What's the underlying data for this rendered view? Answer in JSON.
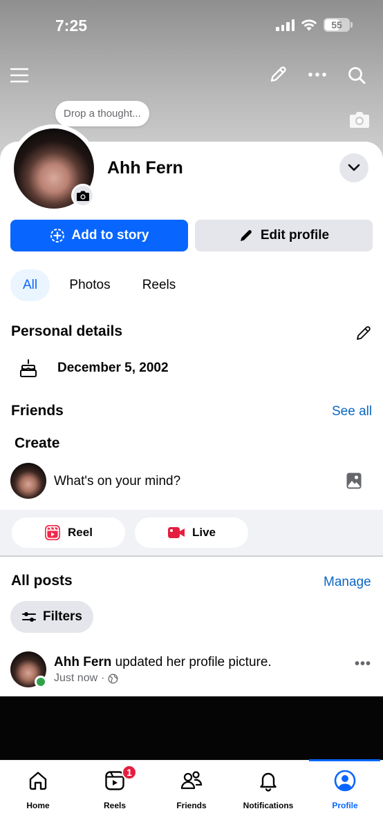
{
  "status_bar": {
    "time": "7:25",
    "battery": "55",
    "battery_level": 0.55
  },
  "header": {
    "menu_icon": "hamburger-menu-icon",
    "edit_icon": "pencil-icon",
    "more_icon": "more-horizontal-icon",
    "search_icon": "search-icon",
    "cover_camera_icon": "camera-icon"
  },
  "thought_bubble": {
    "placeholder": "Drop a thought..."
  },
  "profile": {
    "name": "Ahh Fern"
  },
  "actions": {
    "add_story_label": "Add to story",
    "edit_profile_label": "Edit profile"
  },
  "tabs": [
    {
      "label": "All",
      "active": true
    },
    {
      "label": "Photos",
      "active": false
    },
    {
      "label": "Reels",
      "active": false
    }
  ],
  "personal_details": {
    "title": "Personal details",
    "birthday": "December 5, 2002"
  },
  "friends": {
    "title": "Friends",
    "see_all_label": "See all"
  },
  "create": {
    "title": "Create",
    "prompt": "What's on your mind?",
    "reel_label": "Reel",
    "live_label": "Live"
  },
  "posts": {
    "title": "All posts",
    "manage_label": "Manage",
    "filters_label": "Filters",
    "items": [
      {
        "author": "Ahh Fern",
        "action": " updated her profile picture.",
        "time": "Just now",
        "separator": "·"
      }
    ]
  },
  "bottom_nav": [
    {
      "label": "Home",
      "icon": "home-icon",
      "active": false
    },
    {
      "label": "Reels",
      "icon": "reels-icon",
      "active": false,
      "badge": "1"
    },
    {
      "label": "Friends",
      "icon": "friends-icon",
      "active": false
    },
    {
      "label": "Notifications",
      "icon": "bell-icon",
      "active": false
    },
    {
      "label": "Profile",
      "icon": "profile-icon",
      "active": true
    }
  ],
  "colors": {
    "accent": "#0866ff",
    "link": "#0a66c2",
    "online": "#31a24c",
    "badge": "#e41e3f",
    "reel": "#f0284a",
    "live": "#e41e3f"
  }
}
